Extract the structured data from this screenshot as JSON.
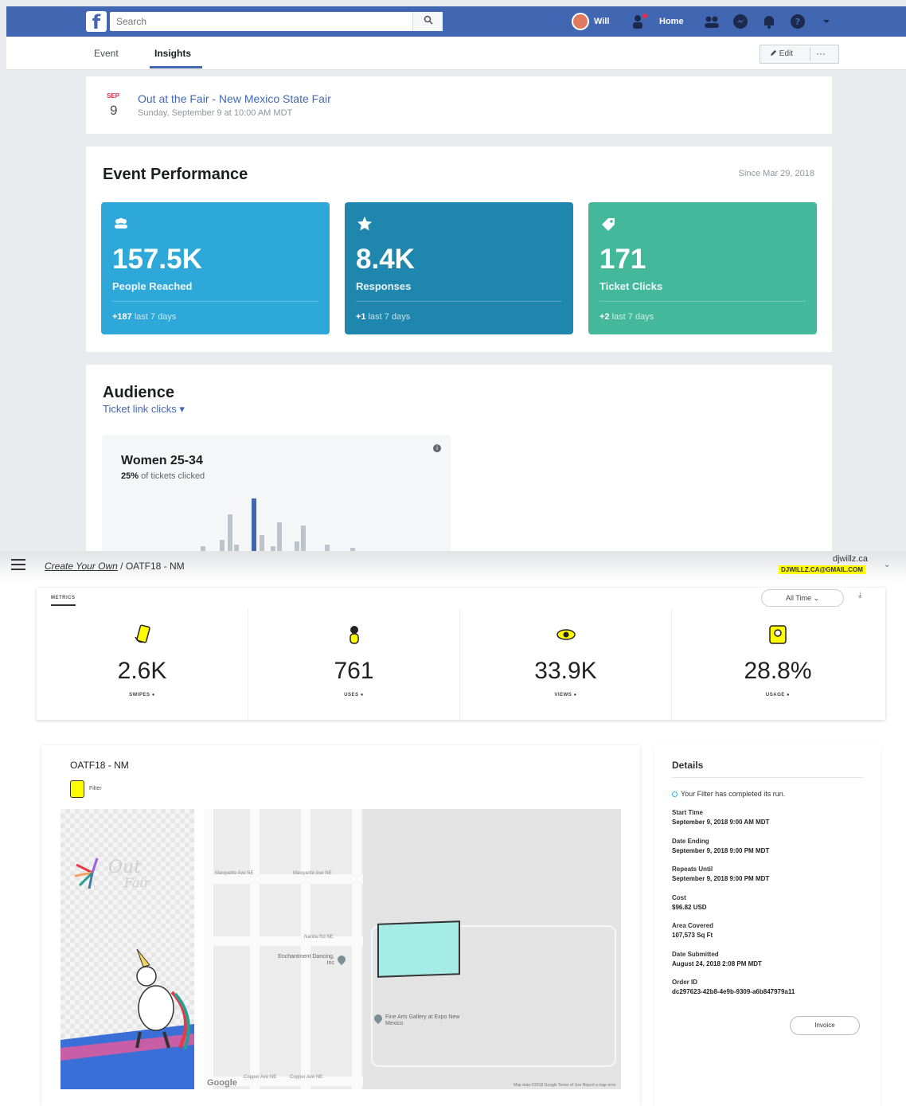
{
  "facebook": {
    "search_placeholder": "Search",
    "nav": {
      "user": "Will",
      "home": "Home"
    },
    "tabs": [
      "Event",
      "Insights"
    ],
    "edit_label": "Edit",
    "more_label": "···",
    "event": {
      "month": "SEP",
      "day": "9",
      "title": "Out at the Fair - New Mexico State Fair",
      "subtitle": "Sunday, September 9 at 10:00 AM MDT"
    },
    "performance": {
      "title": "Event Performance",
      "since": "Since Mar 29, 2018",
      "tiles": [
        {
          "value": "157.5K",
          "label": "People Reached",
          "delta": "+187",
          "period": "last 7 days",
          "color": "#2ea8d8"
        },
        {
          "value": "8.4K",
          "label": "Responses",
          "delta": "+1",
          "period": "last 7 days",
          "color": "#1f86ad"
        },
        {
          "value": "171",
          "label": "Ticket Clicks",
          "delta": "+2",
          "period": "last 7 days",
          "color": "#44b89b"
        }
      ]
    },
    "audience": {
      "title": "Audience",
      "filter": "Ticket link clicks",
      "segment": "Women 25-34",
      "stat_bold": "25%",
      "stat_rest": "of tickets clicked"
    }
  },
  "snapchat": {
    "breadcrumb_root": "Create Your Own",
    "breadcrumb_item": "OATF18 - NM",
    "user_name": "djwillz.ca",
    "user_email": "DJWILLZ.CA@GMAIL.COM",
    "metrics_tab": "METRICS",
    "range": "All Time",
    "metrics": [
      {
        "value": "2.6K",
        "label": "SWIPES",
        "icon": "swipe-phone-icon"
      },
      {
        "value": "761",
        "label": "USES",
        "icon": "person-icon"
      },
      {
        "value": "33.9K",
        "label": "VIEWS",
        "icon": "eye-icon"
      },
      {
        "value": "28.8%",
        "label": "USAGE",
        "icon": "usage-icon"
      }
    ],
    "filter_title": "OATF18 - NM",
    "filter_type": "Filter",
    "map": {
      "streets": [
        "Marquette Ave NE",
        "Marquette Ave NE",
        "Nanita Rd NE",
        "Copper Ave NE",
        "Copper Ave NE"
      ],
      "poi_1": "Enchantment Dancing, Inc",
      "poi_2": "Fine Arts Gallery at Expo New Mexico",
      "footer": "Map data ©2018 Google   Terms of Use   Report a map error",
      "logo": "Google"
    },
    "details": {
      "title": "Details",
      "status": "Your Filter has completed its run.",
      "rows": [
        {
          "key": "Start Time",
          "value": "September 9, 2018 9:00 AM  MDT"
        },
        {
          "key": "Date Ending",
          "value": "September 9, 2018 9:00 PM  MDT"
        },
        {
          "key": "Repeats Until",
          "value": "September 9, 2018 9:00 PM  MDT"
        },
        {
          "key": "Cost",
          "value": "$96.82 USD"
        },
        {
          "key": "Area Covered",
          "value": "107,573 Sq Ft"
        },
        {
          "key": "Date Submitted",
          "value": "August 24, 2018 2:08 PM  MDT"
        },
        {
          "key": "Order ID",
          "value": "dc297623-42b8-4e9b-9309-a6b847979a11"
        }
      ],
      "invoice_label": "Invoice"
    }
  }
}
